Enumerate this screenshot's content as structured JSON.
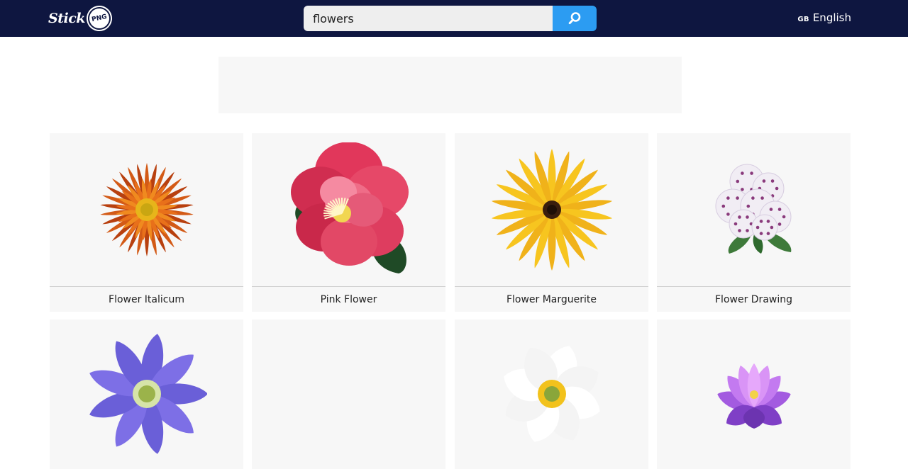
{
  "header": {
    "logo_text": "Stick",
    "logo_badge": "PNG",
    "search": {
      "value": "flowers",
      "icon": "search-icon"
    },
    "language": {
      "code": "GB",
      "label": "English"
    }
  },
  "colors": {
    "header_bg": "#0e1640",
    "accent": "#2c9cf2",
    "card_bg": "#f7f7f7"
  },
  "results": [
    {
      "title": "Flower Italicum",
      "icon": "orange-flower-image"
    },
    {
      "title": "Pink Flower",
      "icon": "pink-camellia-image"
    },
    {
      "title": "Flower Marguerite",
      "icon": "yellow-daisy-image"
    },
    {
      "title": "Flower Drawing",
      "icon": "white-blossom-cluster-image"
    },
    {
      "title": "",
      "icon": "purple-anemone-image"
    },
    {
      "title": "",
      "icon": "empty-placeholder"
    },
    {
      "title": "",
      "icon": "white-anemone-image"
    },
    {
      "title": "",
      "icon": "pink-lotus-image"
    }
  ]
}
